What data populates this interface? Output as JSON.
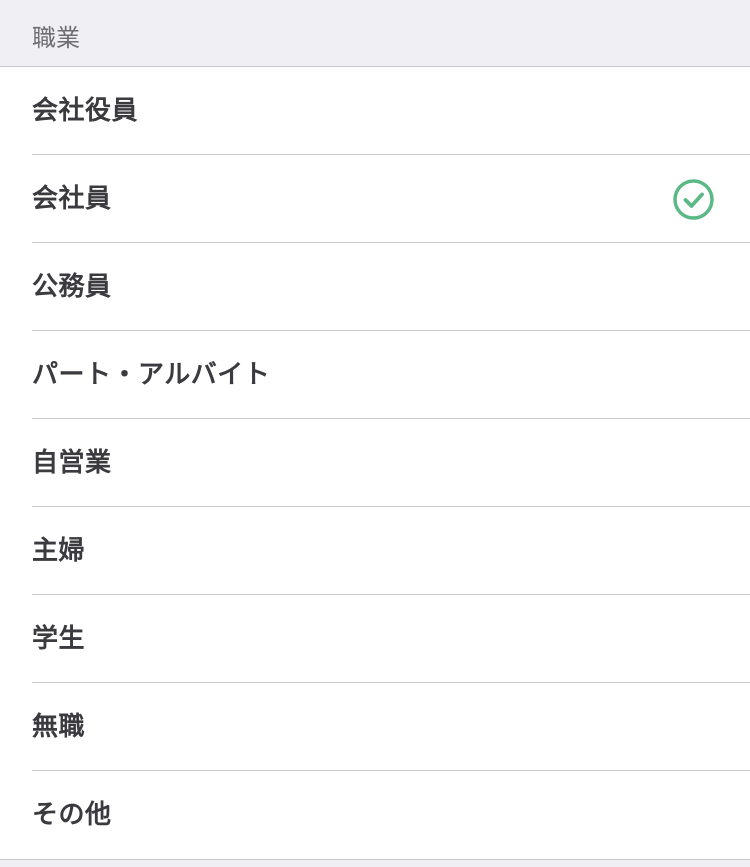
{
  "header": {
    "title": "職業"
  },
  "occupations": [
    {
      "label": "会社役員",
      "selected": false
    },
    {
      "label": "会社員",
      "selected": true
    },
    {
      "label": "公務員",
      "selected": false
    },
    {
      "label": "パート・アルバイト",
      "selected": false
    },
    {
      "label": "自営業",
      "selected": false
    },
    {
      "label": "主婦",
      "selected": false
    },
    {
      "label": "学生",
      "selected": false
    },
    {
      "label": "無職",
      "selected": false
    },
    {
      "label": "その他",
      "selected": false
    }
  ],
  "colors": {
    "check": "#5bb985",
    "text": "#3a3a3f",
    "header_text": "#6d6d72",
    "background": "#efeff4",
    "divider": "#c8c8cc"
  },
  "icons": {
    "selected_indicator": "check-circle-icon"
  }
}
